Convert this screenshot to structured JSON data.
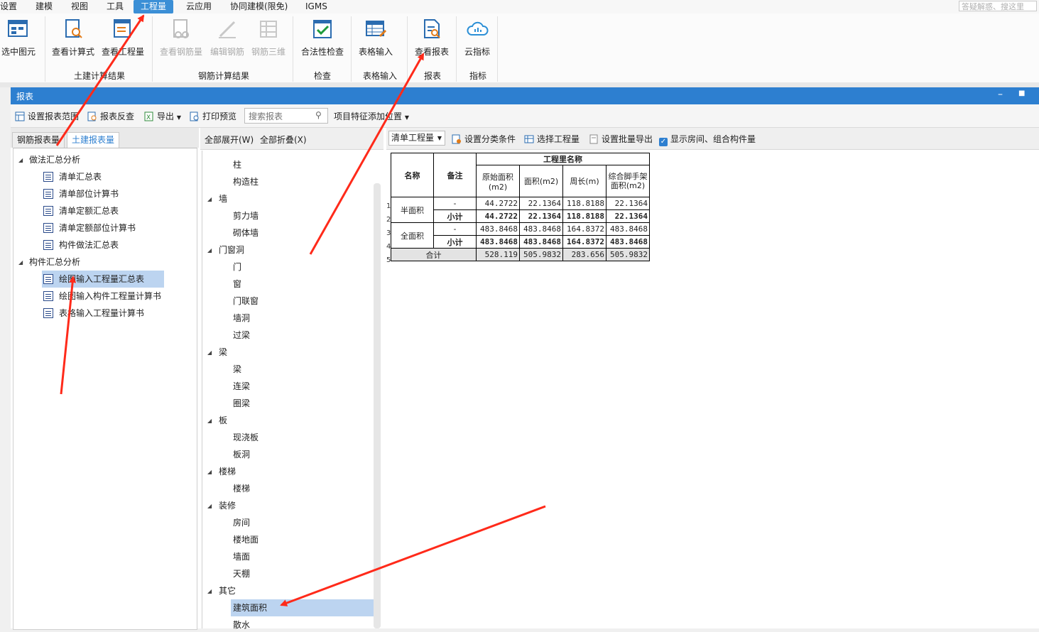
{
  "menu": {
    "items": [
      "设置",
      "建模",
      "视图",
      "工具",
      "工程量",
      "云应用",
      "协同建模(限免)",
      "IGMS"
    ],
    "active": "工程量",
    "help_search_placeholder": "答疑解惑、搜这里"
  },
  "ribbon": {
    "buttons": [
      {
        "label": "选中图元",
        "enabled": true
      },
      {
        "label": "查看计算式",
        "enabled": true
      },
      {
        "label": "查看工程量",
        "enabled": true
      },
      {
        "label": "查看钢筋量",
        "enabled": false
      },
      {
        "label": "编辑钢筋",
        "enabled": false
      },
      {
        "label": "钢筋三维",
        "enabled": false
      },
      {
        "label": "合法性检查",
        "enabled": true
      },
      {
        "label": "表格输入",
        "enabled": true
      },
      {
        "label": "查看报表",
        "enabled": true
      },
      {
        "label": "云指标",
        "enabled": true
      }
    ],
    "groups": [
      "土建计算结果",
      "钢筋计算结果",
      "检查",
      "表格输入",
      "报表",
      "指标"
    ]
  },
  "report_window": {
    "title": "报表",
    "toolbar": {
      "set_range": "设置报表范围",
      "reverse_check": "报表反查",
      "export": "导出",
      "print_preview": "打印预览",
      "search_placeholder": "搜索报表",
      "item_feature": "项目特征添加位置"
    },
    "left_tabs": [
      "钢筋报表量",
      "土建报表量"
    ],
    "active_left_tab": "土建报表量",
    "left_tree": [
      {
        "label": "做法汇总分析",
        "children": [
          "清单汇总表",
          "清单部位计算书",
          "清单定额汇总表",
          "清单定额部位计算书",
          "构件做法汇总表"
        ]
      },
      {
        "label": "构件汇总分析",
        "children": [
          "绘图输入工程量汇总表",
          "绘图输入构件工程量计算书",
          "表格输入工程量计算书"
        ]
      }
    ],
    "left_selected": "绘图输入工程量汇总表",
    "middle_head": {
      "expand_all": "全部展开(W)",
      "collapse_all": "全部折叠(X)"
    },
    "middle_tree": [
      {
        "label": "",
        "children": [
          "柱",
          "构造柱"
        ]
      },
      {
        "label": "墙",
        "children": [
          "剪力墙",
          "砌体墙"
        ]
      },
      {
        "label": "门窗洞",
        "children": [
          "门",
          "窗",
          "门联窗",
          "墙洞",
          "过梁"
        ]
      },
      {
        "label": "梁",
        "children": [
          "梁",
          "连梁",
          "圈梁"
        ]
      },
      {
        "label": "板",
        "children": [
          "现浇板",
          "板洞"
        ]
      },
      {
        "label": "楼梯",
        "children": [
          "楼梯"
        ]
      },
      {
        "label": "装修",
        "children": [
          "房间",
          "楼地面",
          "墙面",
          "天棚"
        ]
      },
      {
        "label": "其它",
        "children": [
          "建筑面积",
          "散水"
        ]
      }
    ],
    "middle_selected": "建筑面积",
    "right_toolbar": {
      "combo_value": "清单工程量",
      "set_category": "设置分类条件",
      "select_quantity": "选择工程量",
      "batch_export": "设置批量导出",
      "show_room": "显示房间、组合构件量",
      "show_room_checked": true
    },
    "table": {
      "group_header": "工程里名称",
      "headers": [
        "名称",
        "备注",
        "原始面积(m2)",
        "面积(m2)",
        "周长(m)",
        "综合脚手架面积(m2)"
      ],
      "row_numbers": [
        "1",
        "2",
        "3",
        "4",
        "5"
      ],
      "groups": [
        {
          "name": "半面积",
          "rows": [
            {
              "note": "-",
              "values": [
                "44.2722",
                "22.1364",
                "118.8188",
                "22.1364"
              ],
              "bold": false
            },
            {
              "note": "小计",
              "values": [
                "44.2722",
                "22.1364",
                "118.8188",
                "22.1364"
              ],
              "bold": true
            }
          ]
        },
        {
          "name": "全面积",
          "rows": [
            {
              "note": "-",
              "values": [
                "483.8468",
                "483.8468",
                "164.8372",
                "483.8468"
              ],
              "bold": false
            },
            {
              "note": "小计",
              "values": [
                "483.8468",
                "483.8468",
                "164.8372",
                "483.8468"
              ],
              "bold": true
            }
          ]
        }
      ],
      "total": {
        "label": "合计",
        "values": [
          "528.119",
          "505.9832",
          "283.656",
          "505.9832"
        ]
      }
    }
  },
  "colors": {
    "accent": "#2d7fd0",
    "selection": "#bcd4f0",
    "arrow": "#ff2a1a"
  }
}
